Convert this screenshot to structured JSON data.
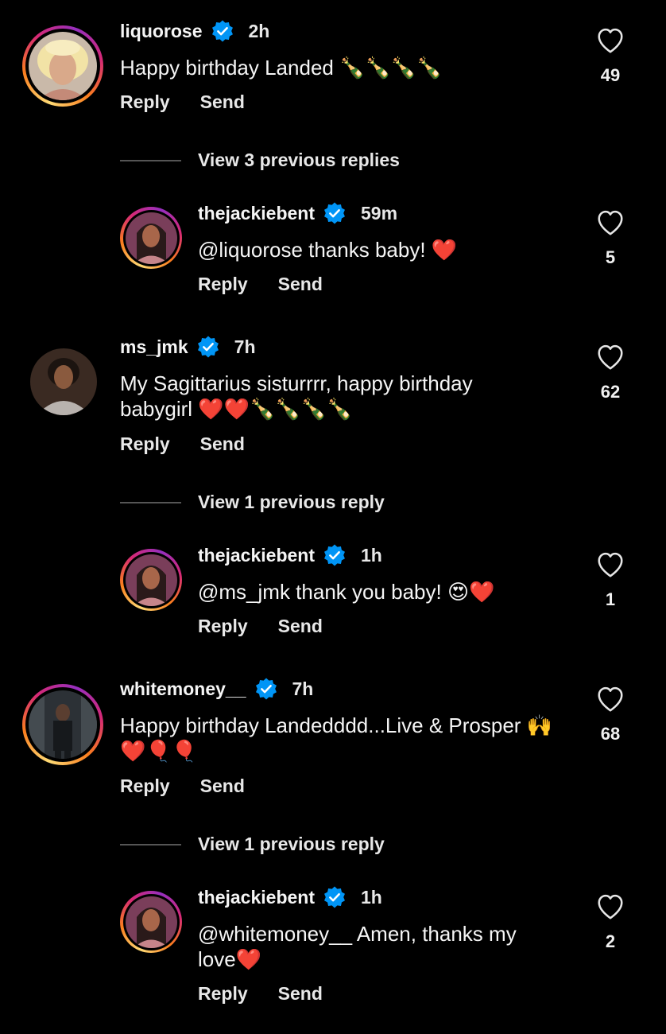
{
  "comments": [
    {
      "username": "liquorose",
      "verified": true,
      "time": "2h",
      "text": "Happy birthday Landed 🍾🍾🍾🍾",
      "reply_label": "Reply",
      "send_label": "Send",
      "likes": "49",
      "view_previous": "View 3 previous replies",
      "reply": {
        "username": "thejackiebent",
        "verified": true,
        "time": "59m",
        "text": "@liquorose thanks baby! ❤️",
        "reply_label": "Reply",
        "send_label": "Send",
        "likes": "5"
      }
    },
    {
      "username": "ms_jmk",
      "verified": true,
      "time": "7h",
      "text": "My Sagittarius sisturrrr, happy birthday babygirl ❤️❤️🍾🍾🍾🍾",
      "reply_label": "Reply",
      "send_label": "Send",
      "likes": "62",
      "view_previous": "View 1 previous reply",
      "reply": {
        "username": "thejackiebent",
        "verified": true,
        "time": "1h",
        "text": "@ms_jmk thank you baby! 😍❤️",
        "reply_label": "Reply",
        "send_label": "Send",
        "likes": "1"
      }
    },
    {
      "username": "whitemoney__",
      "verified": true,
      "time": "7h",
      "text": "Happy birthday Landedddd...Live & Prosper 🙌❤️🎈🎈",
      "reply_label": "Reply",
      "send_label": "Send",
      "likes": "68",
      "view_previous": "View 1 previous reply",
      "reply": {
        "username": "thejackiebent",
        "verified": true,
        "time": "1h",
        "text": "@whitemoney__ Amen, thanks my love❤️",
        "reply_label": "Reply",
        "send_label": "Send",
        "likes": "2"
      }
    }
  ],
  "icons": {
    "verified": "verified-badge-icon",
    "like": "heart-outline-icon"
  },
  "colors": {
    "verified": "#0095f6",
    "background": "#000000",
    "ring_start": "#feda75",
    "ring_end": "#d62976"
  }
}
